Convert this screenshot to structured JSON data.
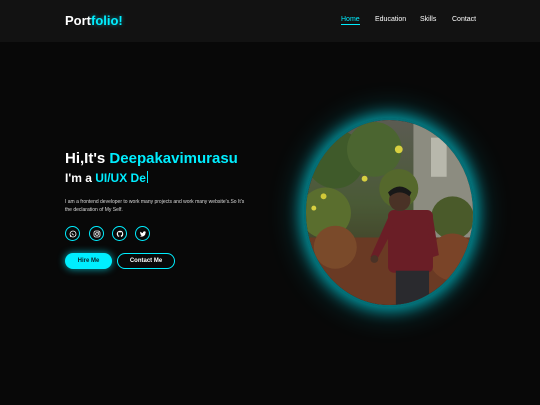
{
  "brand": {
    "logo_main": "Port",
    "logo_accent": "folio!"
  },
  "nav": {
    "items": [
      "Home",
      "Education",
      "Skills",
      "Contact"
    ]
  },
  "hero": {
    "greeting": "Hi,It's ",
    "name": "Deepakavimurasu",
    "role_prefix": "I'm a ",
    "role_typed": "UI/UX De",
    "description": "I am a frontend developer to work many projects and work many website's.So It's the declaration of My Self.",
    "primary_button": "Hire Me",
    "secondary_button": "Contact Me"
  },
  "socials": [
    {
      "icon": "whatsapp-icon"
    },
    {
      "icon": "instagram-icon"
    },
    {
      "icon": "github-icon"
    },
    {
      "icon": "twitter-icon"
    }
  ],
  "colors": {
    "accent": "#00eeff",
    "background": "#080808",
    "navbar": "#121212"
  }
}
